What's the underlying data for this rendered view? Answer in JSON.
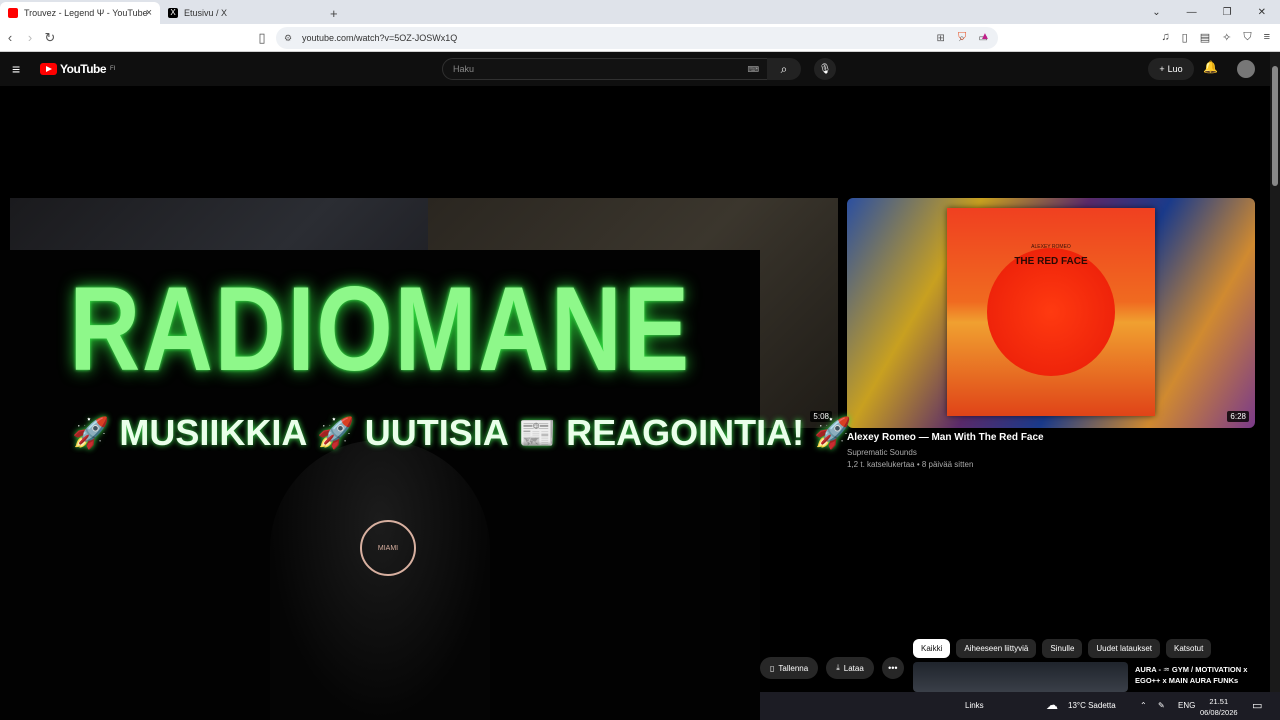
{
  "browser": {
    "tabs": [
      {
        "title": "Trouvez - Legend Ψ - YouTube",
        "active": true,
        "favicon_color": "#ff0000"
      },
      {
        "title": "Etusivu / X",
        "active": false,
        "favicon_color": "#000000"
      }
    ],
    "new_tab_icon": "+",
    "url": "youtube.com/watch?v=5OZ-JOSWx1Q",
    "window_controls": [
      "chevron-down-icon",
      "minimize-icon",
      "restore-icon",
      "close-icon"
    ]
  },
  "youtube": {
    "logo_text": "YouTube",
    "region": "FI",
    "search_placeholder": "Haku",
    "create_label": "Luo"
  },
  "videos": [
    {
      "duration": "5:08"
    },
    {
      "title": "Alexey Romeo — Man With The Red Face",
      "channel": "Suprematic Sounds",
      "meta": "1,2 t. katselukertaa • 8 päivää sitten",
      "duration": "6:28",
      "cover_artist": "ALEXEY ROMEO",
      "cover_title": "THE RED FACE"
    }
  ],
  "overlay": {
    "brand": "RADIOMANE",
    "tagline": [
      "MUSIIKKIA",
      "UUTISIA",
      "REAGOINTIA!"
    ],
    "cap_logo": "MIAMI"
  },
  "chips": [
    "Kaikki",
    "Aiheeseen liittyviä",
    "Sinulle",
    "Uudet lataukset",
    "Katsotut"
  ],
  "actions": {
    "save": "Tallenna",
    "download": "Lataa"
  },
  "sidebar_video_title": "AURA - ♒ GYM / MOTIVATION x EGO++ x MAIN AURA FUNKs",
  "taskbar": {
    "links": "Links",
    "weather": "13°C Sadetta",
    "lang": "ENG",
    "time": "21.51",
    "date": "06/08/2026"
  },
  "colors": {
    "accent": "#ff0000",
    "neon_green": "#8ef88a"
  }
}
